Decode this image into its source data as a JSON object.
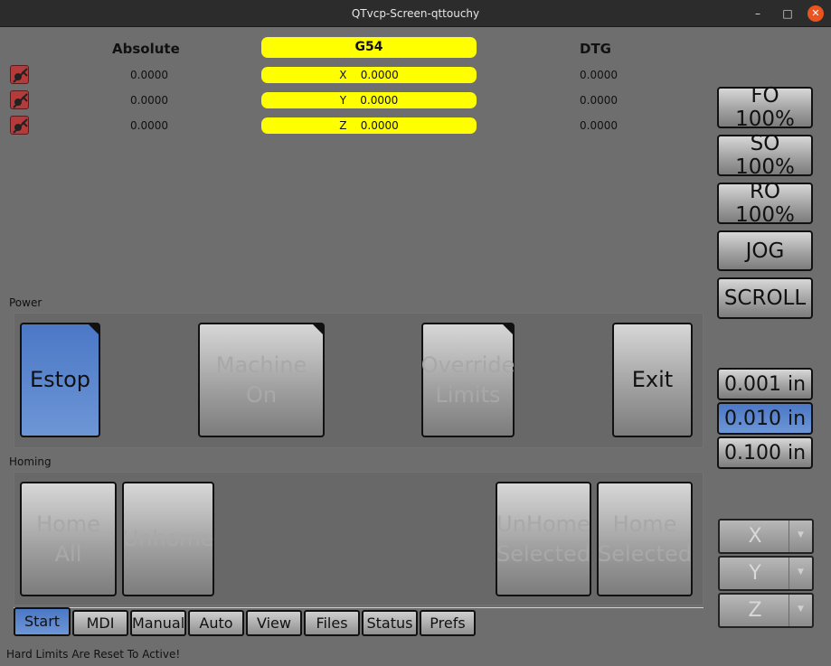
{
  "window": {
    "title": "QTvcp-Screen-qttouchy",
    "minimize_glyph": "–",
    "maximize_glyph": "□",
    "close_glyph": "✕"
  },
  "dro": {
    "absolute_header": "Absolute",
    "work_offset": "G54",
    "dtg_header": "DTG",
    "rows": [
      {
        "axis": "X",
        "absolute": "0.0000",
        "relative": "0.0000",
        "dtg": "0.0000"
      },
      {
        "axis": "Y",
        "absolute": "0.0000",
        "relative": "0.0000",
        "dtg": "0.0000"
      },
      {
        "axis": "Z",
        "absolute": "0.0000",
        "relative": "0.0000",
        "dtg": "0.0000"
      }
    ],
    "home_status_icon": "not-homed-icon"
  },
  "power": {
    "label": "Power",
    "estop": "Estop",
    "machine_on": "Machine On",
    "override_limits": "Override\nLimits",
    "exit": "Exit"
  },
  "homing": {
    "label": "Homing",
    "home_all": "Home All",
    "unhome": "Unhome",
    "unhome_selected": "UnHome\nSelected",
    "home_selected": "Home\nSelected"
  },
  "side_panel": {
    "feed_override": "FO 100%",
    "spindle_override": "SO 100%",
    "rapid_override": "RO 100%",
    "jog": "JOG",
    "scroll": "SCROLL",
    "increments": [
      "0.001 in",
      "0.010 in",
      "0.100 in"
    ],
    "selected_increment": "0.010 in",
    "axis_selectors": [
      "X",
      "Y",
      "Z"
    ]
  },
  "tabs": [
    "Start",
    "MDI",
    "Manual",
    "Auto",
    "View",
    "Files",
    "Status",
    "Prefs"
  ],
  "active_tab": "Start",
  "status_bar": "Hard Limits Are Reset To Active!",
  "colors": {
    "background": "#6e6e6e",
    "dro_highlight": "#ffff00",
    "active_blue": "#5d88cf",
    "titlebar": "#2c2c2c",
    "close_button": "#e95420"
  }
}
